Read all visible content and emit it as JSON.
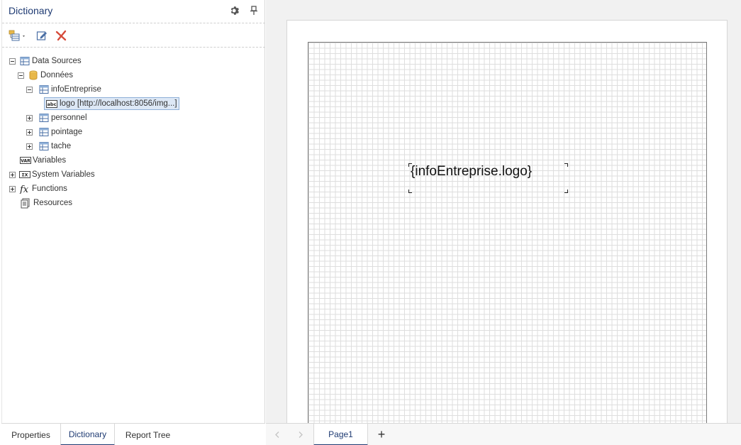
{
  "dictionary": {
    "title": "Dictionary",
    "header_icons": [
      "gear-icon",
      "pin-icon"
    ],
    "toolbar": [
      "new-item-dropdown-icon",
      "edit-icon",
      "delete-icon"
    ],
    "tree": {
      "data_sources": "Data Sources",
      "donnees": "Données",
      "info_entreprise": "infoEntreprise",
      "logo": "logo [http://localhost:8056/img...]",
      "personnel": "personnel",
      "pointage": "pointage",
      "tache": "tache",
      "variables": "Variables",
      "system_variables": "System Variables",
      "functions": "Functions",
      "resources": "Resources"
    }
  },
  "bottom_tabs": {
    "properties": "Properties",
    "dictionary": "Dictionary",
    "report_tree": "Report Tree",
    "active": "Dictionary"
  },
  "designer": {
    "component_text": "{infoEntreprise.logo}",
    "page_tab": "Page1",
    "add_page": "+"
  },
  "colors": {
    "accent": "#1f3b73",
    "delete": "#d64b3a",
    "database": "#e8b84a"
  }
}
